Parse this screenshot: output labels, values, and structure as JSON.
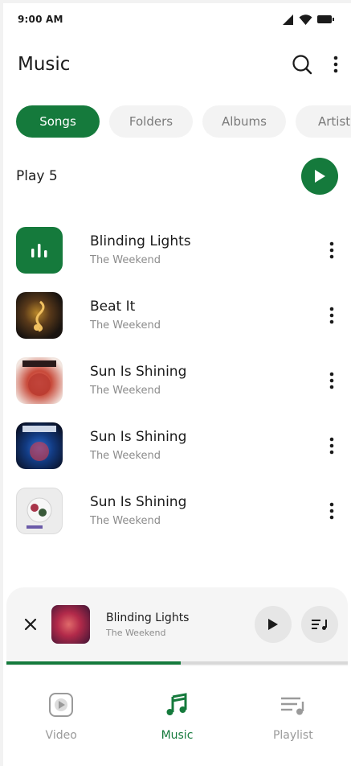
{
  "status_bar": {
    "time": "9:00 AM",
    "icons": [
      "signal-icon",
      "wifi-icon",
      "battery-icon"
    ]
  },
  "app_bar": {
    "title": "Music",
    "actions": [
      "search-icon",
      "more-vert-icon"
    ]
  },
  "chips": [
    {
      "label": "Songs",
      "active": true
    },
    {
      "label": "Folders",
      "active": false
    },
    {
      "label": "Albums",
      "active": false
    },
    {
      "label": "Artist",
      "active": false
    }
  ],
  "play_all": {
    "label": "Play 5"
  },
  "songs": [
    {
      "title": "Blinding Lights",
      "artist": "The Weekend",
      "art": "equalizer-icon"
    },
    {
      "title": "Beat It",
      "artist": "The Weekend",
      "art": "album-cover"
    },
    {
      "title": "Sun Is Shining",
      "artist": "The Weekend",
      "art": "album-cover"
    },
    {
      "title": "Sun Is Shining",
      "artist": "The Weekend",
      "art": "album-cover"
    },
    {
      "title": "Sun Is Shining",
      "artist": "The Weekend",
      "art": "album-cover"
    }
  ],
  "mini_player": {
    "title": "Blinding Lights",
    "artist": "The Weekend",
    "progress": 0.51
  },
  "bottom_nav": [
    {
      "label": "Video",
      "icon": "video-icon",
      "active": false
    },
    {
      "label": "Music",
      "icon": "music-note-icon",
      "active": true
    },
    {
      "label": "Playlist",
      "icon": "playlist-icon",
      "active": false
    }
  ],
  "colors": {
    "accent": "#157a3c",
    "chip_bg": "#f3f3f3",
    "muted_text": "#8c8c8c"
  }
}
